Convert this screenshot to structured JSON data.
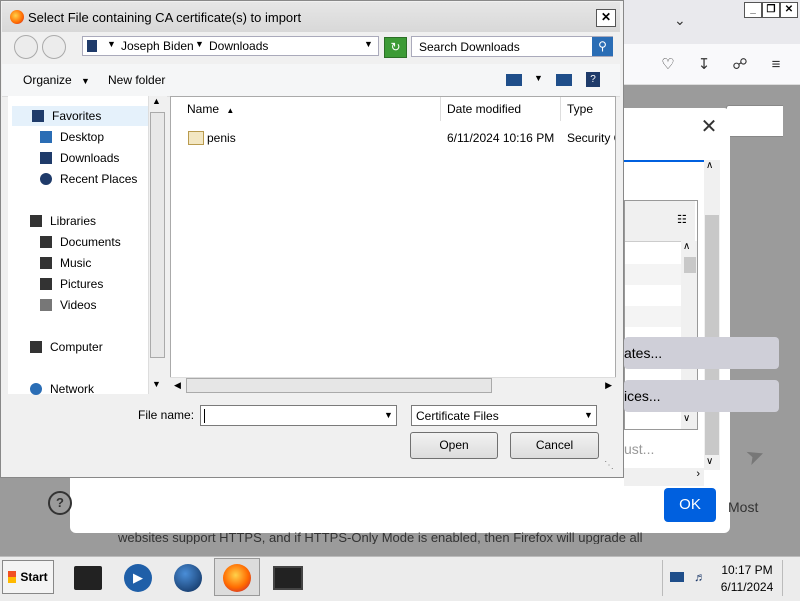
{
  "dialog": {
    "title": "Select File containing CA certificate(s) to import",
    "breadcrumb": [
      "Joseph Biden",
      "Downloads"
    ],
    "search_placeholder": "Search Downloads",
    "organize_label": "Organize",
    "new_folder_label": "New folder",
    "nav": {
      "favorites": "Favorites",
      "desktop": "Desktop",
      "downloads": "Downloads",
      "recent_places": "Recent Places",
      "libraries": "Libraries",
      "documents": "Documents",
      "music": "Music",
      "pictures": "Pictures",
      "videos": "Videos",
      "computer": "Computer",
      "network": "Network"
    },
    "columns": {
      "name": "Name",
      "date_modified": "Date modified",
      "type": "Type"
    },
    "files": [
      {
        "name": "penis",
        "date_modified": "6/11/2024 10:16 PM",
        "type": "Security C"
      }
    ],
    "file_name_label": "File name:",
    "file_name_value": "",
    "file_type_value": "Certificate Files",
    "open_label": "Open",
    "cancel_label": "Cancel"
  },
  "firefox_modal": {
    "button1_text": "ates...",
    "button2_text": "ices...",
    "button3_text": "ust...",
    "ok_label": "OK",
    "most_text": "Most",
    "bottom_text": "websites support HTTPS, and if HTTPS-Only Mode is enabled, then Firefox will upgrade all"
  },
  "taskbar": {
    "start_label": "Start",
    "clock_time": "10:17 PM",
    "clock_date": "6/11/2024"
  }
}
